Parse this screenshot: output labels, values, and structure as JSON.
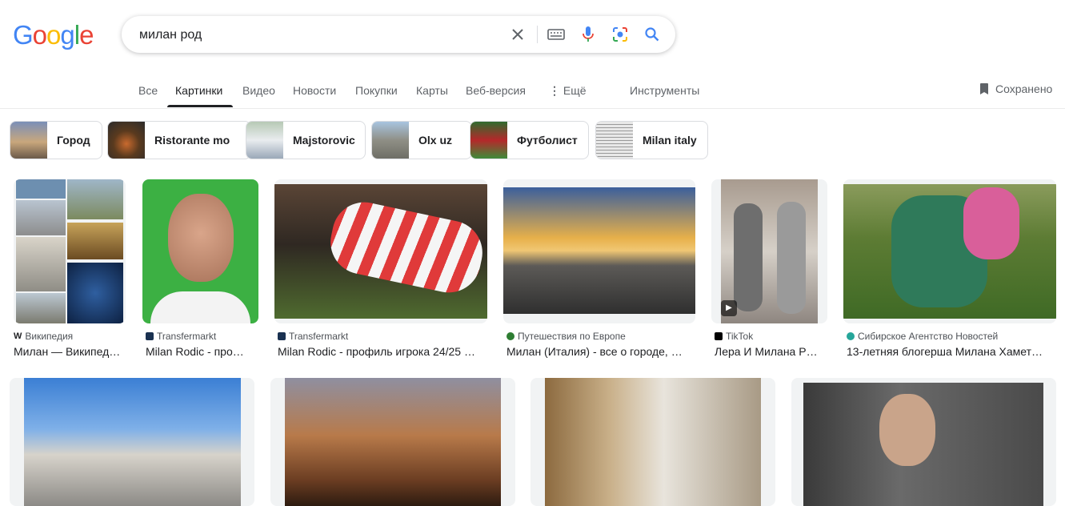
{
  "logo": {
    "letters": [
      "G",
      "o",
      "o",
      "g",
      "l",
      "e"
    ],
    "colors": [
      "#4285f4",
      "#ea4335",
      "#fbbc05",
      "#4285f4",
      "#34a853",
      "#ea4335"
    ]
  },
  "search": {
    "query": "милан род"
  },
  "tabs": [
    {
      "label": "Все"
    },
    {
      "label": "Картинки"
    },
    {
      "label": "Видео"
    },
    {
      "label": "Новости"
    },
    {
      "label": "Покупки"
    },
    {
      "label": "Карты"
    },
    {
      "label": "Веб-версия"
    },
    {
      "label": "Ещё"
    },
    {
      "label": "Инструменты"
    }
  ],
  "saved_label": "Сохранено",
  "chips": [
    {
      "label": "Город"
    },
    {
      "label": "Ristorante mo"
    },
    {
      "label": "Majstorovic"
    },
    {
      "label": "Olx uz"
    },
    {
      "label": "Футболист"
    },
    {
      "label": "Milan italy"
    }
  ],
  "results": [
    {
      "source": "Википедия",
      "title": "Милан — Википед…"
    },
    {
      "source": "Transfermarkt",
      "title": "Milan Rodic - про…"
    },
    {
      "source": "Transfermarkt",
      "title": "Milan Rodic - профиль игрока 24/25 …"
    },
    {
      "source": "Путешествия по Европе",
      "title": "Милан (Италия) - все о городе, …"
    },
    {
      "source": "TikTok",
      "title": "Лера И Милана Р…"
    },
    {
      "source": "Сибирское Агентство Новостей",
      "title": "13-летняя блогерша Милана Хамет…"
    }
  ],
  "colors": {
    "accent": "#1a73e8",
    "mic_blue": "#4285f4"
  }
}
